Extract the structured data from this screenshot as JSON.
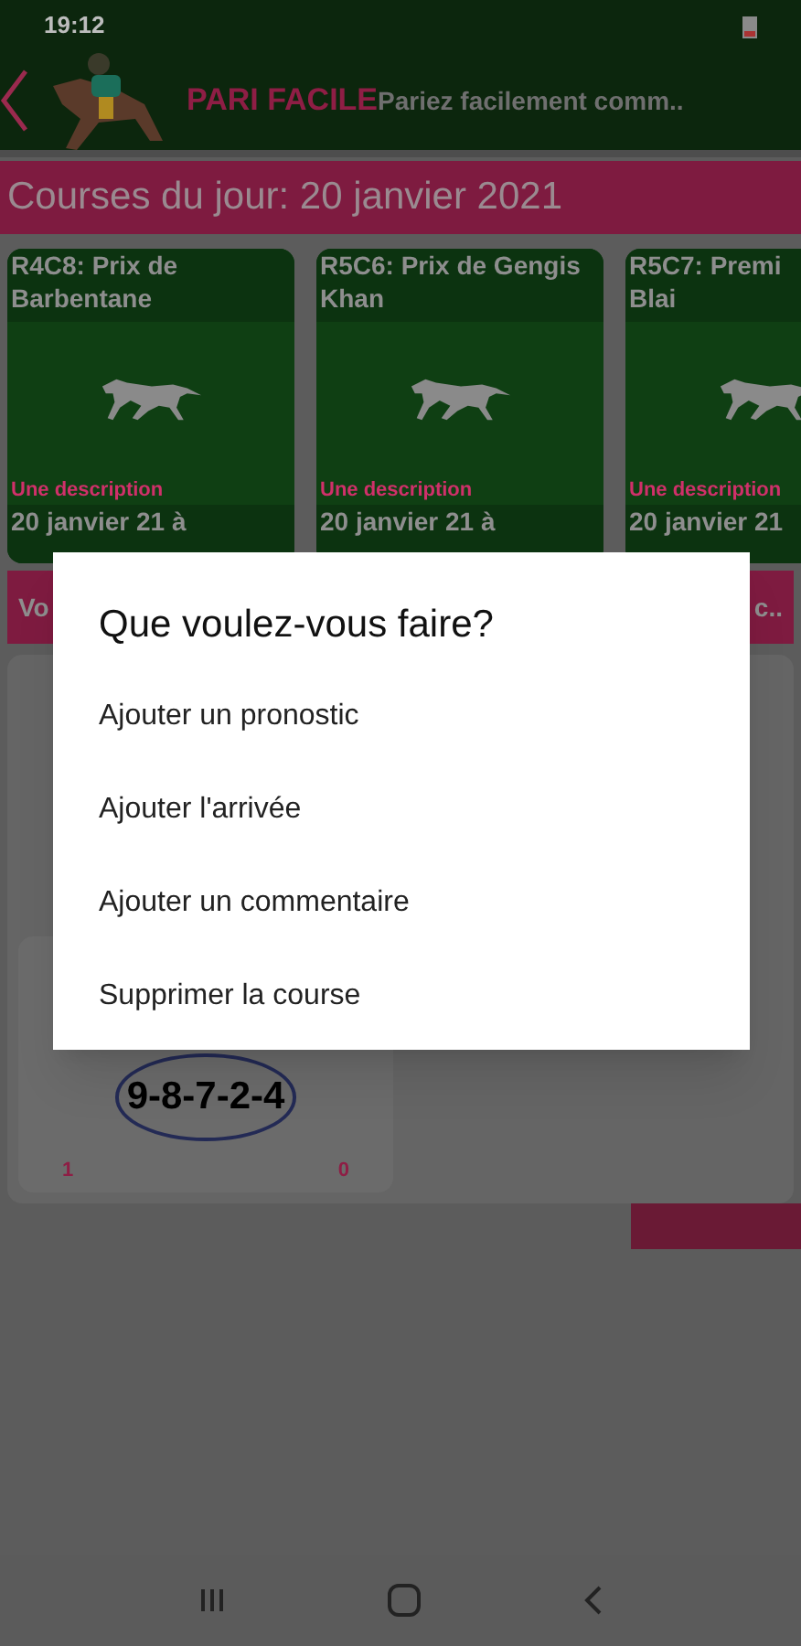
{
  "status_bar": {
    "time": "19:12"
  },
  "header": {
    "app_name": "PARI FACILE",
    "tagline": "Pariez facilement comm.."
  },
  "banner": {
    "title": "Courses du jour: 20 janvier 2021"
  },
  "races": [
    {
      "title_lines": [
        "R4C8: Prix de",
        "Barbentane"
      ],
      "description": "Une description",
      "date": "20 janvier 21 à"
    },
    {
      "title_lines": [
        "R5C6: Prix de Gengis",
        "Khan"
      ],
      "description": "Une description",
      "date": "20 janvier 21 à"
    },
    {
      "title_lines": [
        "R5C7: Premi",
        "Blai"
      ],
      "description": "Une description",
      "date": "20 janvier 21"
    }
  ],
  "section_bar": {
    "left": "Vo",
    "right": "c.."
  },
  "prognosis_card": {
    "numbers": "9-8-7-2-4",
    "stats": [
      "1",
      "0"
    ]
  },
  "dialog": {
    "title": "Que voulez-vous faire?",
    "options": [
      "Ajouter un pronostic",
      "Ajouter l'arrivée",
      "Ajouter un commentaire",
      "Supprimer la course"
    ]
  }
}
